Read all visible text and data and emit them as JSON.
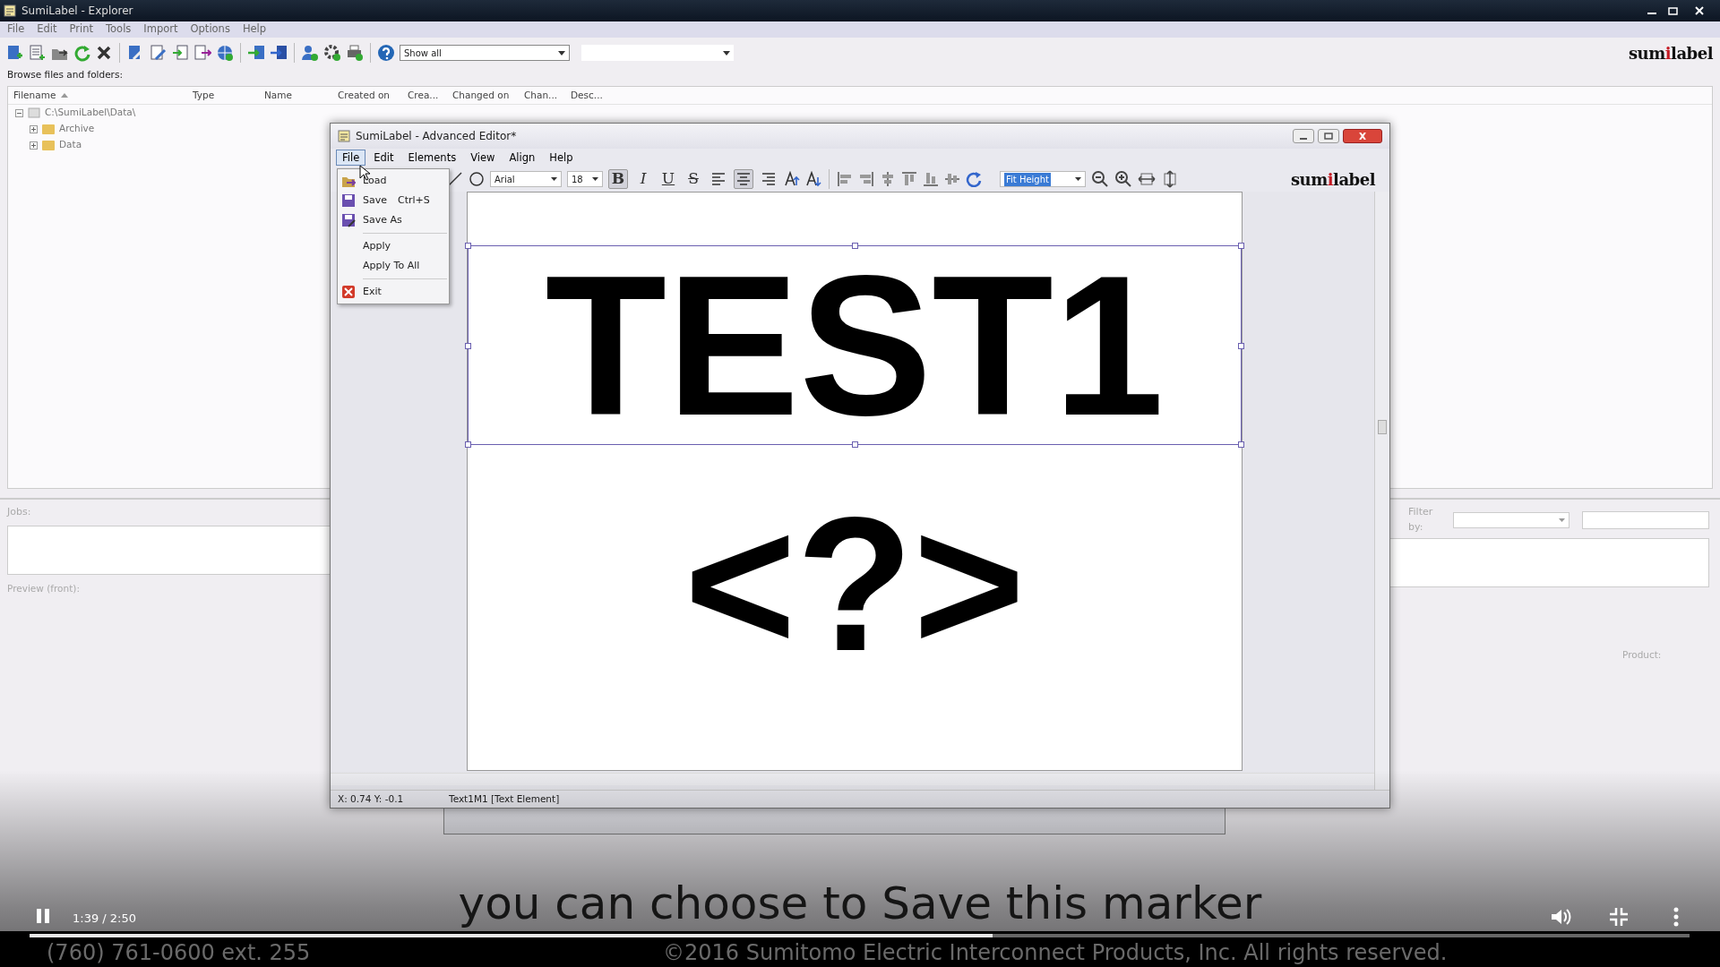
{
  "explorer": {
    "title": "SumiLabel - Explorer",
    "menu": [
      "File",
      "Edit",
      "Print",
      "Tools",
      "Import",
      "Options",
      "Help"
    ],
    "view_filter": "Show all",
    "logo": {
      "before": "sum",
      "accent": "i",
      "after": "label"
    },
    "browse_label": "Browse files and folders:",
    "columns": [
      {
        "label": "Filename",
        "sorted": true
      },
      {
        "label": "Type",
        "sorted": false
      },
      {
        "label": "Name",
        "sorted": false
      },
      {
        "label": "Created on",
        "sorted": false
      },
      {
        "label": "Crea...",
        "sorted": false
      },
      {
        "label": "Changed on",
        "sorted": false
      },
      {
        "label": "Chan...",
        "sorted": false
      },
      {
        "label": "Desc...",
        "sorted": false
      }
    ],
    "tree": [
      {
        "label": "C:\\SumiLabel\\Data\\",
        "expanded": true,
        "children": [
          {
            "label": "Archive",
            "expanded": false
          },
          {
            "label": "Data",
            "expanded": false
          }
        ]
      }
    ],
    "jobs_label": "Jobs:",
    "filter_label": "Filter by:",
    "preview_label": "Preview (front):",
    "product_label": "Product:"
  },
  "editor": {
    "title": "SumiLabel - Advanced Editor*",
    "menu": [
      {
        "label": "File",
        "selected": true
      },
      {
        "label": "Edit",
        "selected": false
      },
      {
        "label": "Elements",
        "selected": false
      },
      {
        "label": "View",
        "selected": false
      },
      {
        "label": "Align",
        "selected": false
      },
      {
        "label": "Help",
        "selected": false
      }
    ],
    "file_menu": [
      [
        {
          "label": "Load",
          "kind": "load"
        },
        {
          "label": "Save",
          "shortcut": "Ctrl+S",
          "kind": "save"
        },
        {
          "label": "Save As",
          "kind": "saveas"
        }
      ],
      [
        {
          "label": "Apply",
          "kind": "plain"
        },
        {
          "label": "Apply To All",
          "kind": "plain"
        }
      ],
      [
        {
          "label": "Exit",
          "kind": "exit"
        }
      ]
    ],
    "font": "Arial",
    "size": "18",
    "zoom": "Fit Height",
    "format_buttons": [
      {
        "label": "B",
        "kind": "bold",
        "on": true
      },
      {
        "label": "I",
        "kind": "italic",
        "on": false
      },
      {
        "label": "U",
        "kind": "underline",
        "on": false
      },
      {
        "label": "S",
        "kind": "strike",
        "on": false
      }
    ],
    "align_buttons": [
      {
        "kind": "left",
        "on": false
      },
      {
        "kind": "center",
        "on": true
      },
      {
        "kind": "right",
        "on": false
      }
    ],
    "logo": {
      "before": "sum",
      "accent": "i",
      "after": "label"
    },
    "label_texts": [
      {
        "text": "TEST1",
        "selected": true
      },
      {
        "text": "<?>",
        "selected": false
      }
    ],
    "status": [
      "X: 0.74 Y: -0.1",
      "Text1M1 [Text Element]"
    ]
  },
  "video": {
    "caption": "you can choose to Save this marker",
    "time": "1:39 / 2:50",
    "level": 0.58,
    "footer": [
      "(760) 761-0600 ext. 255",
      "©2016 Sumitomo Electric Interconnect Products, Inc. All rights reserved."
    ]
  }
}
